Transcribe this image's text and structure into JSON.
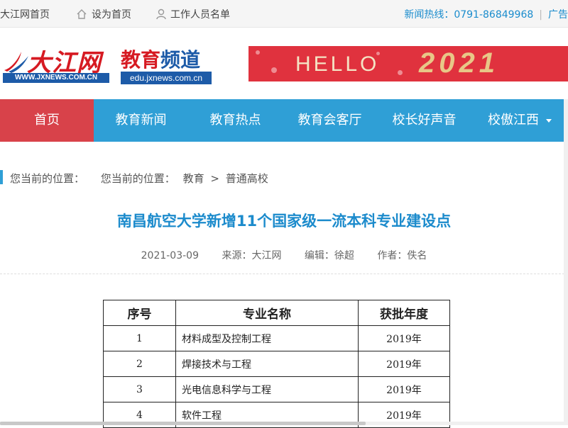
{
  "topbar": {
    "home_link": "大江网首页",
    "set_home": "设为首页",
    "staff_list": "工作人员名单",
    "hotline_label": "新闻热线：",
    "hotline_number": "0791-86849968",
    "ads_link": "广告"
  },
  "header": {
    "logo_cn": "大江网",
    "logo_url": "WWW.JXNEWS.COM.CN",
    "channel_red": "教育",
    "channel_blue": "频道",
    "channel_url": "edu.jxnews.com.cn",
    "banner_hello": "HELLO",
    "banner_year": "2021"
  },
  "nav": {
    "items": [
      {
        "label": "首页",
        "active": true
      },
      {
        "label": "教育新闻"
      },
      {
        "label": "教育热点"
      },
      {
        "label": "教育会客厅"
      },
      {
        "label": "校长好声音"
      },
      {
        "label": "校傲江西"
      }
    ]
  },
  "breadcrumb": {
    "label1": "您当前的位置：",
    "label2": "您当前的位置：",
    "level1": "教育",
    "separator": ">",
    "level2": "普通高校"
  },
  "article": {
    "title": "南昌航空大学新增11个国家级一流本科专业建设点",
    "date": "2021-03-09",
    "source": "来源：大江网",
    "editor": "编辑：徐超",
    "author": "作者：佚名"
  },
  "table": {
    "headers": [
      "序号",
      "专业名称",
      "获批年度"
    ],
    "rows": [
      [
        "1",
        "材料成型及控制工程",
        "2019年"
      ],
      [
        "2",
        "焊接技术与工程",
        "2019年"
      ],
      [
        "3",
        "光电信息科学与工程",
        "2019年"
      ],
      [
        "4",
        "软件工程",
        "2019年"
      ]
    ]
  },
  "colors": {
    "nav_blue": "#2f9fd6",
    "nav_active": "#d8424a",
    "title_blue": "#1c8bcc",
    "brand_red": "#d61a22"
  }
}
